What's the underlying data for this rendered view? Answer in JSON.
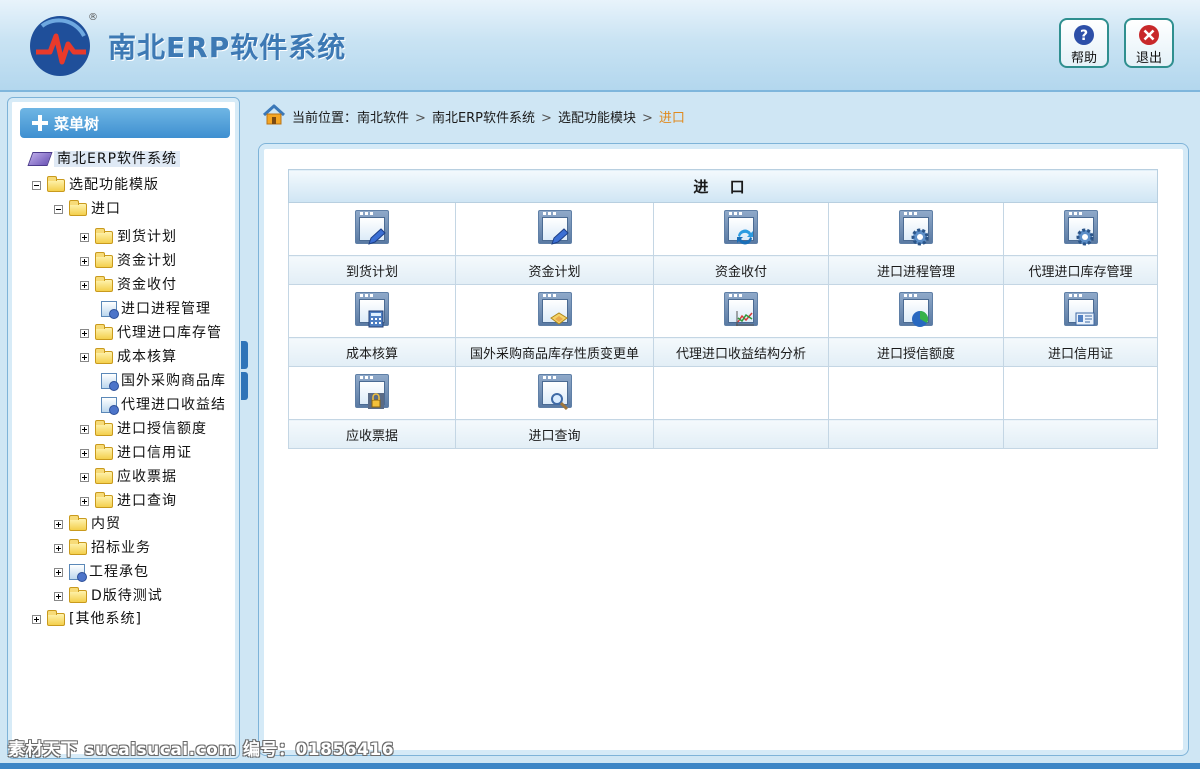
{
  "header": {
    "app_title": "南北ERP软件系统",
    "reg_mark": "®",
    "help_label": "帮助",
    "exit_label": "退出",
    "accent_color": "#3d79b4"
  },
  "sidebar": {
    "title": "菜单树",
    "root": "南北ERP软件系统",
    "nodes": {
      "n1": "选配功能模版",
      "n2": "进口",
      "n3": "到货计划",
      "n4": "资金计划",
      "n5": "资金收付",
      "n6": "进口进程管理",
      "n7": "代理进口库存管",
      "n8": "成本核算",
      "n9": "国外采购商品库",
      "n10": "代理进口收益结",
      "n11": "进口授信额度",
      "n12": "进口信用证",
      "n13": "应收票据",
      "n14": "进口查询",
      "n15": "内贸",
      "n16": "招标业务",
      "n17": "工程承包",
      "n18": "D版待测试",
      "n19": "[其他系统]"
    }
  },
  "breadcrumb": {
    "prefix": "当前位置：",
    "items": [
      "南北软件",
      "南北ERP软件系统",
      "选配功能模块"
    ],
    "current": "进口",
    "separator": ">",
    "current_color": "#e08a1e"
  },
  "panel": {
    "title": "进 口",
    "modules": [
      {
        "label": "到货计划",
        "icon": "pen-icon"
      },
      {
        "label": "资金计划",
        "icon": "pen-icon"
      },
      {
        "label": "资金收付",
        "icon": "exchange-icon"
      },
      {
        "label": "进口进程管理",
        "icon": "gear-icon"
      },
      {
        "label": "代理进口库存管理",
        "icon": "gear-icon"
      },
      {
        "label": "成本核算",
        "icon": "calculator-icon"
      },
      {
        "label": "国外采购商品库存性质变更单",
        "icon": "package-icon"
      },
      {
        "label": "代理进口收益结构分析",
        "icon": "line-chart-icon"
      },
      {
        "label": "进口授信额度",
        "icon": "pie-chart-icon"
      },
      {
        "label": "进口信用证",
        "icon": "id-card-icon"
      },
      {
        "label": "应收票据",
        "icon": "lock-icon"
      },
      {
        "label": "进口查询",
        "icon": "magnifier-icon"
      }
    ]
  },
  "watermark": "素材天下 sucaisucai.com  编号：01856416"
}
